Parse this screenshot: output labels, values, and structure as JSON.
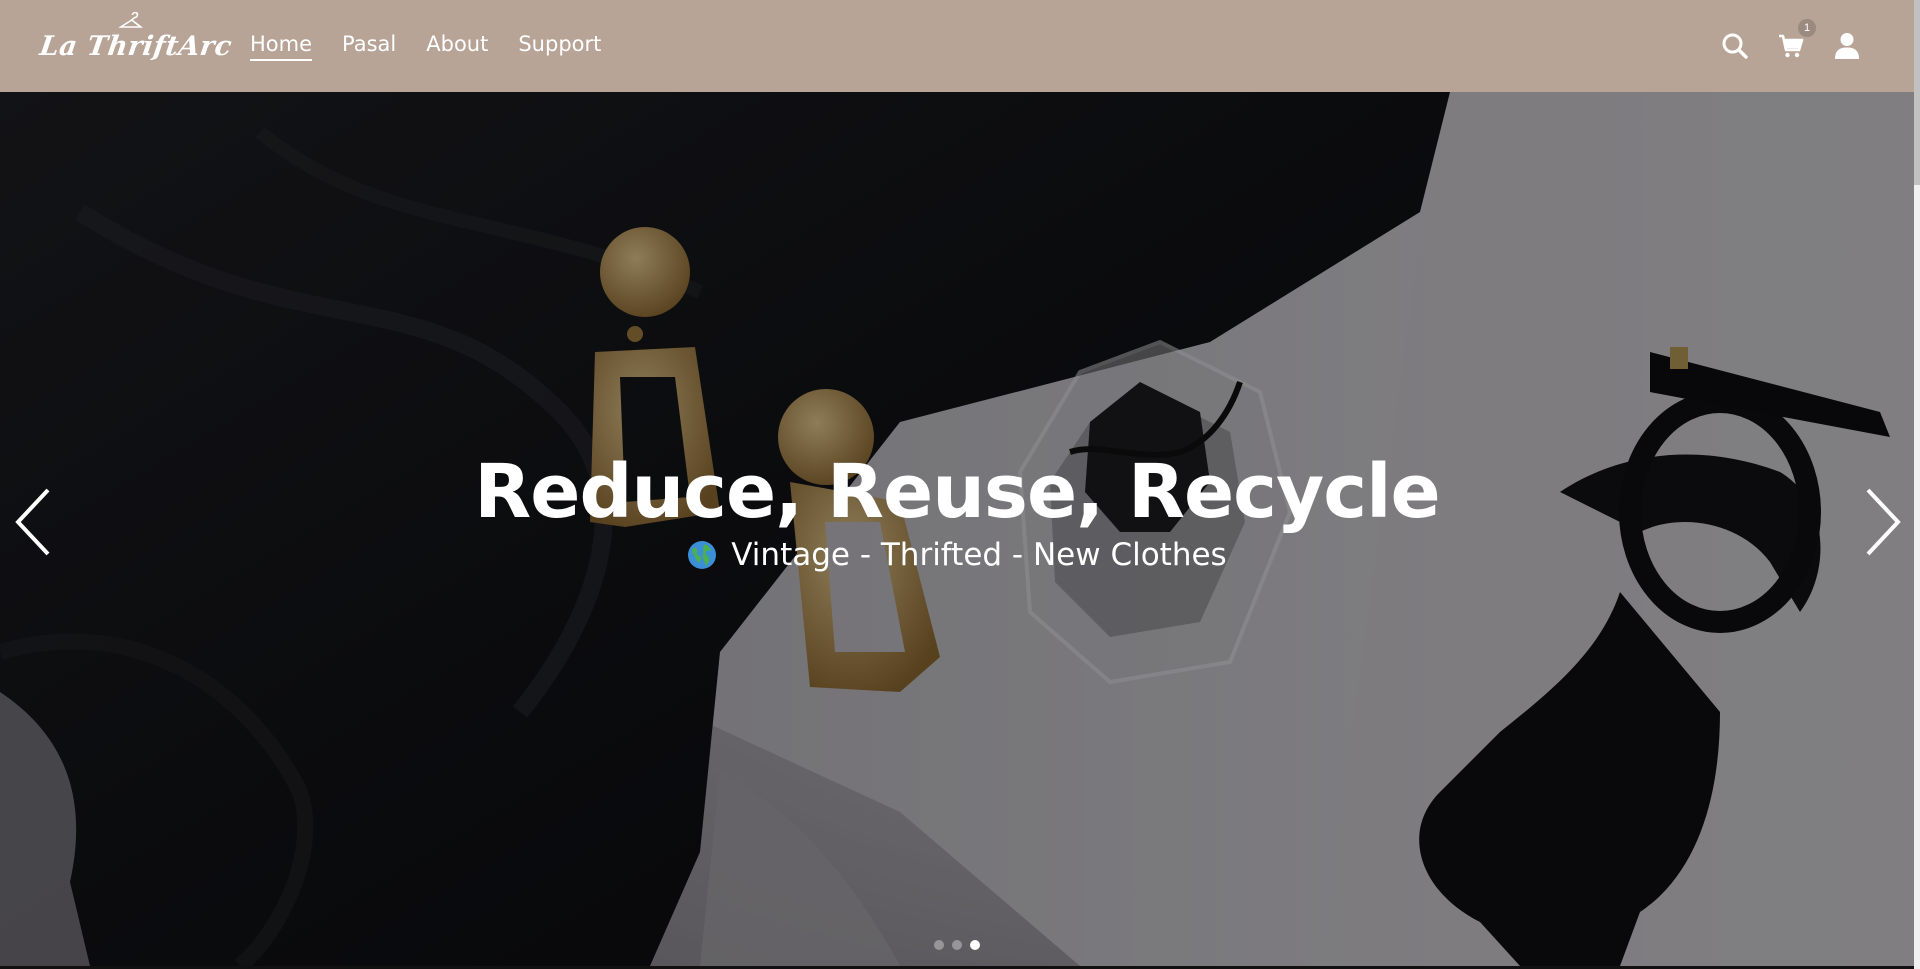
{
  "brand": {
    "logo_text": "La ThriftArc"
  },
  "nav": {
    "links": [
      {
        "label": "Home",
        "active": true
      },
      {
        "label": "Pasal",
        "active": false
      },
      {
        "label": "About",
        "active": false
      },
      {
        "label": "Support",
        "active": false
      }
    ]
  },
  "header_icons": {
    "search": "search-icon",
    "cart": "cart-icon",
    "cart_count": "1",
    "account": "user-icon"
  },
  "hero": {
    "title": "Reduce, Reuse, Recycle",
    "subtitle": "Vintage - Thrifted - New Clothes",
    "subtitle_icon": "globe-icon",
    "slides_total": 3,
    "active_slide": 3
  },
  "colors": {
    "header_bg": "#b7a497",
    "text": "#ffffff",
    "gold": "#c8a060"
  }
}
